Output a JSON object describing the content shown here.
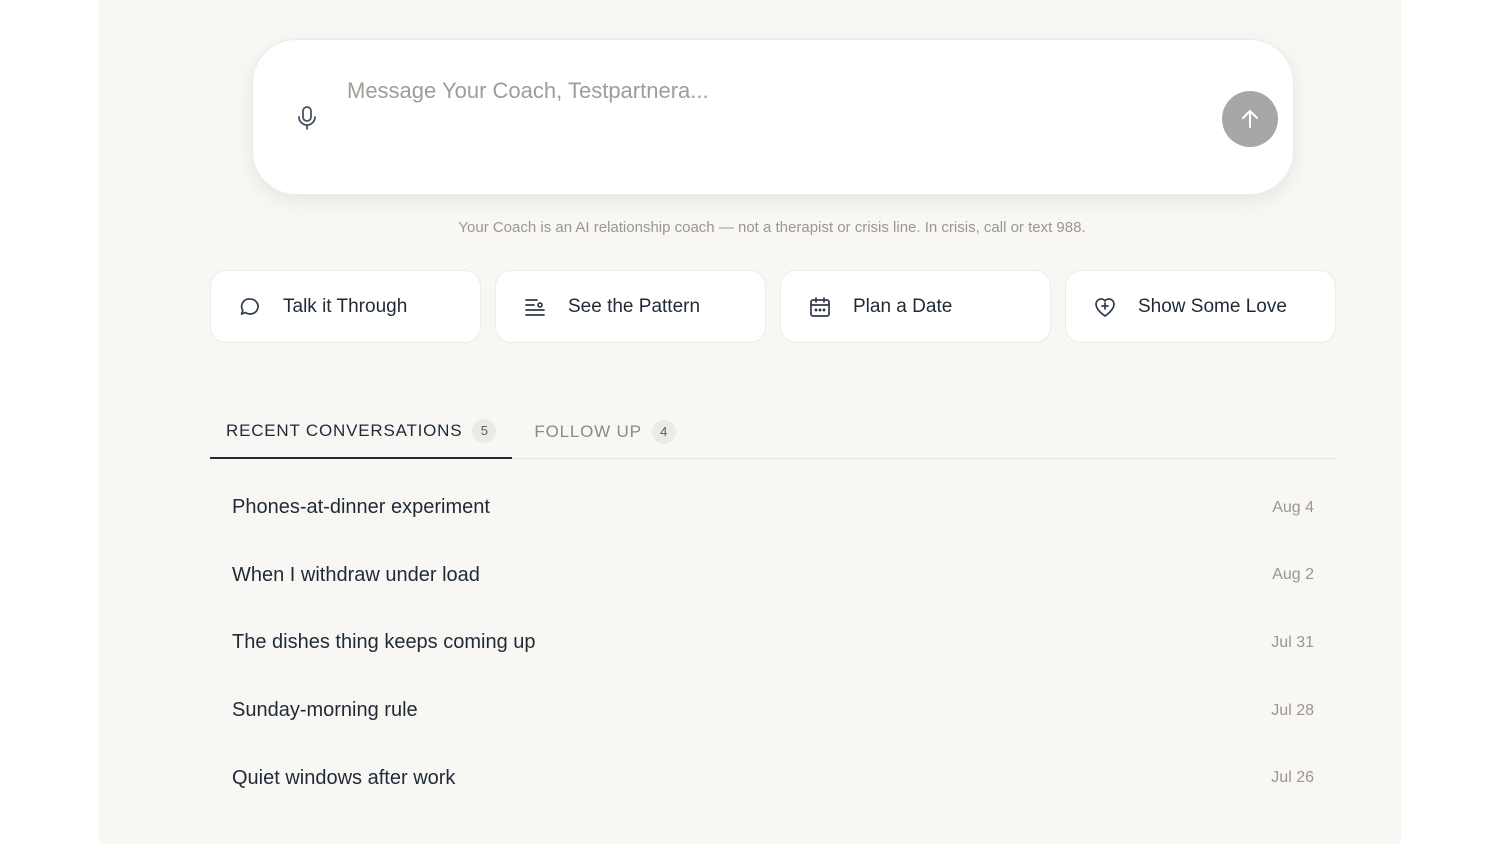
{
  "composer": {
    "placeholder": "Message Your Coach, Testpartnera...",
    "mic_icon": "microphone-icon",
    "send_icon": "arrow-up-icon"
  },
  "disclaimer": "Your Coach is an AI relationship coach — not a therapist or crisis line. In crisis, call or text 988.",
  "actions": [
    {
      "label": "Talk it Through",
      "icon": "chat-bubble-icon"
    },
    {
      "label": "See the Pattern",
      "icon": "lines-pattern-icon"
    },
    {
      "label": "Plan a Date",
      "icon": "calendar-icon"
    },
    {
      "label": "Show Some Love",
      "icon": "heart-plus-icon"
    }
  ],
  "tabs": [
    {
      "label": "RECENT CONVERSATIONS",
      "count": "5"
    },
    {
      "label": "FOLLOW UP",
      "count": "4"
    }
  ],
  "conversations": [
    {
      "title": "Phones-at-dinner experiment",
      "date": "Aug 4"
    },
    {
      "title": "When I withdraw under load",
      "date": "Aug 2"
    },
    {
      "title": "The dishes thing keeps coming up",
      "date": "Jul 31"
    },
    {
      "title": "Sunday-morning rule",
      "date": "Jul 28"
    },
    {
      "title": "Quiet windows after work",
      "date": "Jul 26"
    }
  ],
  "colors": {
    "page_bg": "#f8f7f4",
    "text": "#1f2a37",
    "muted": "#9a978f",
    "send_button": "#a8a7a5"
  }
}
